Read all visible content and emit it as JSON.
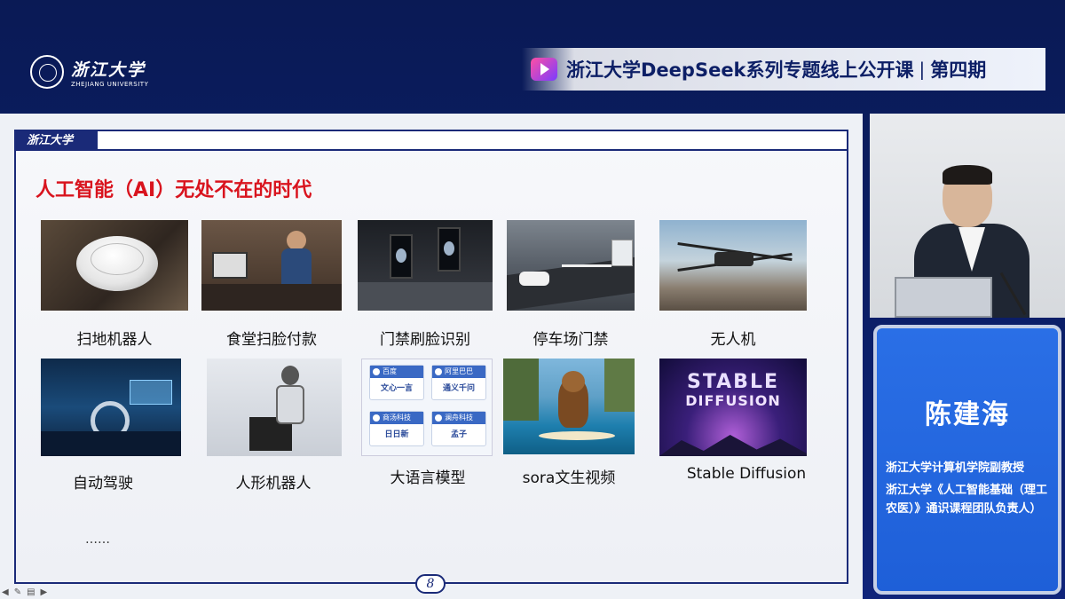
{
  "header": {
    "logo_cn": "浙江大学",
    "logo_en": "ZHEJIANG UNIVERSITY",
    "course_title": "浙江大学DeepSeek系列专题线上公开课",
    "separator": "|",
    "course_issue": "第四期"
  },
  "slide": {
    "header_logo": "浙江大学",
    "title": "人工智能（AI）无处不在的时代",
    "page_number": "8",
    "tiles": [
      {
        "caption": "扫地机器人"
      },
      {
        "caption": "食堂扫脸付款"
      },
      {
        "caption": "门禁刷脸识别"
      },
      {
        "caption": "停车场门禁"
      },
      {
        "caption": "无人机"
      },
      {
        "caption": "自动驾驶"
      },
      {
        "caption": "人形机器人"
      },
      {
        "caption": "大语言模型"
      },
      {
        "caption": "sora文生视频"
      },
      {
        "caption": "Stable Diffusion"
      }
    ],
    "ellipsis": "……",
    "llm_cards": [
      {
        "brand": "百度",
        "product": "文心一言"
      },
      {
        "brand": "阿里巴巴",
        "product": "通义千问"
      },
      {
        "brand": "商汤科技",
        "product": "日日新"
      },
      {
        "brand": "澜舟科技",
        "product": "孟子"
      }
    ],
    "sd_text_line1": "STABLE",
    "sd_text_line2": "DIFFUSION"
  },
  "speaker": {
    "name": "陈建海",
    "role_1": "浙江大学计算机学院副教授",
    "role_2": "浙江大学《人工智能基础（理工农医）》通识课程团队负责人）"
  },
  "colors": {
    "title_red": "#d9141e",
    "navy": "#1a2a78",
    "name_card_blue": "#2a6fe6"
  }
}
